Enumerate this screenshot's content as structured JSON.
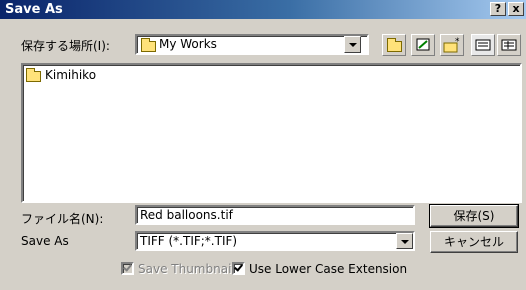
{
  "window": {
    "title": "Save As",
    "help_button": "?",
    "close_button": "x"
  },
  "save_in": {
    "label": "保存する場所(I):",
    "value": "My Works",
    "folder_icon": "folder-icon"
  },
  "toolbar": {
    "up_folder_icon": "up-one-level-icon",
    "desktop_icon": "desktop-icon",
    "new_folder_icon": "new-folder-icon",
    "list_view_icon": "list-view-icon",
    "details_view_icon": "details-view-icon"
  },
  "file_list": {
    "items": [
      {
        "name": "Kimihiko",
        "icon": "folder-icon"
      }
    ]
  },
  "filename": {
    "label": "ファイル名(N):",
    "value": "Red balloons.tif"
  },
  "save_as_type": {
    "label": "Save As",
    "value": "TIFF (*.TIF;*.TIF)"
  },
  "buttons": {
    "save": "保存(S)",
    "cancel": "キャンセル"
  },
  "options": {
    "save_thumbnail": {
      "label": "Save Thumbnail",
      "checked": true,
      "enabled": false
    },
    "lower_case_extension": {
      "label": "Use Lower Case Extension",
      "checked": true,
      "enabled": true
    }
  },
  "colors": {
    "titlebar_start": "#0a246a",
    "titlebar_end": "#a6caf0",
    "face": "#d4d0c8",
    "folder": "#ffe27a"
  }
}
